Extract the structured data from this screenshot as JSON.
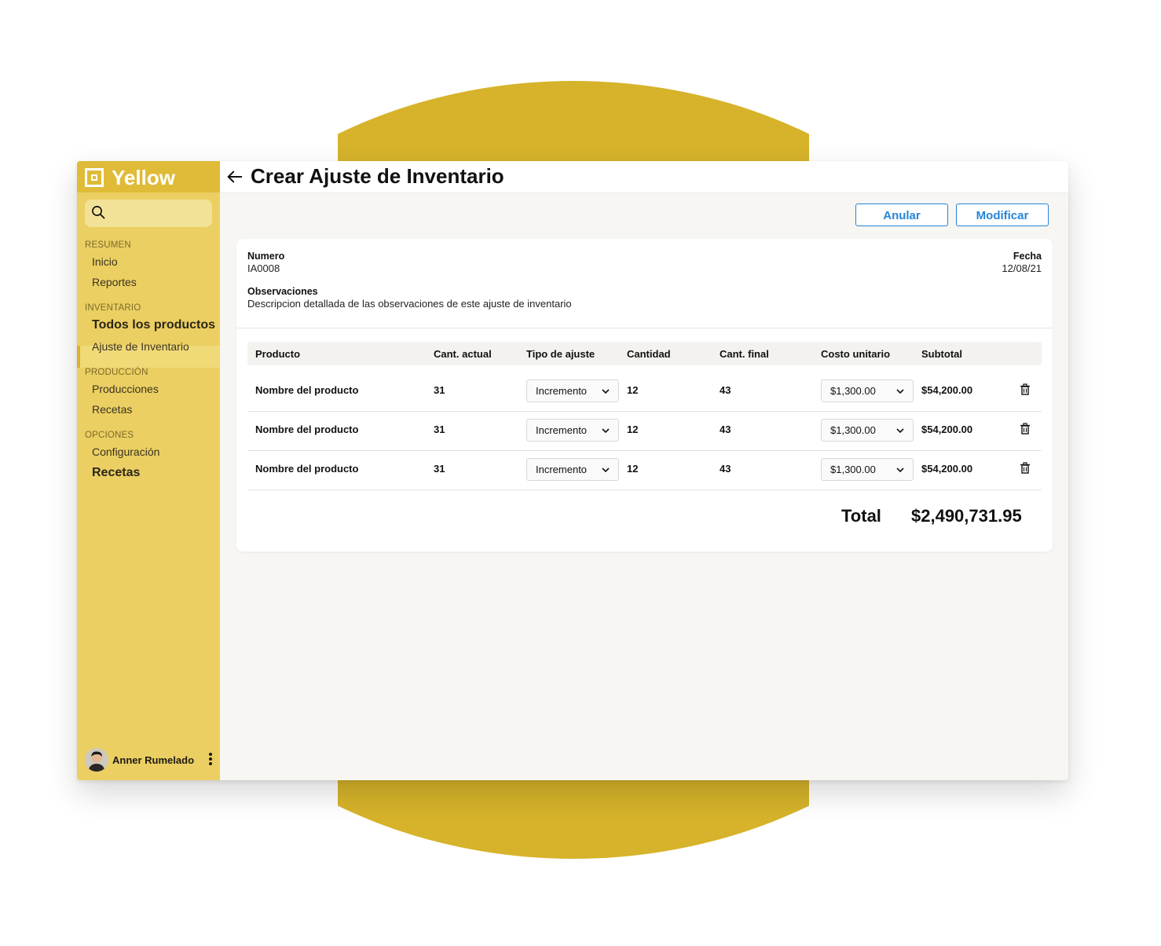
{
  "colors": {
    "accent_circle": "#d6b32a",
    "sidebar": "#ebcf62",
    "brand_bar": "#dfbb38",
    "primary_button": "#2684d8"
  },
  "brand": {
    "name": "Yellow"
  },
  "sidebar": {
    "sections": [
      {
        "title": "RESUMEN",
        "items": [
          "Inicio",
          "Reportes"
        ]
      },
      {
        "title": "INVENTARIO",
        "items": [
          "Todos los productos",
          "Ajuste de Inventario"
        ]
      },
      {
        "title": "PRODUCCIÓN",
        "items": [
          "Producciones",
          "Recetas"
        ]
      },
      {
        "title": "OPCIONES",
        "items": [
          "Configuración",
          "Recetas"
        ]
      }
    ],
    "user": {
      "name": "Anner Rumelado"
    }
  },
  "header": {
    "title": "Crear Ajuste de Inventario"
  },
  "actions": {
    "cancel_label": "Anular",
    "modify_label": "Modificar"
  },
  "details": {
    "numero_label": "Numero",
    "numero_value": "IA0008",
    "fecha_label": "Fecha",
    "fecha_value": "12/08/21",
    "observaciones_label": "Observaciones",
    "observaciones_value": "Descripcion detallada de las observaciones de este ajuste de inventario"
  },
  "table": {
    "columns": [
      "Producto",
      "Cant. actual",
      "Tipo de ajuste",
      "Cantidad",
      "Cant. final",
      "Costo unitario",
      "Subtotal"
    ],
    "rows": [
      {
        "producto": "Nombre del producto",
        "cant_actual": "31",
        "tipo": "Incremento",
        "cantidad": "12",
        "cant_final": "43",
        "costo": "$1,300.00",
        "subtotal": "$54,200.00"
      },
      {
        "producto": "Nombre del producto",
        "cant_actual": "31",
        "tipo": "Incremento",
        "cantidad": "12",
        "cant_final": "43",
        "costo": "$1,300.00",
        "subtotal": "$54,200.00"
      },
      {
        "producto": "Nombre del producto",
        "cant_actual": "31",
        "tipo": "Incremento",
        "cantidad": "12",
        "cant_final": "43",
        "costo": "$1,300.00",
        "subtotal": "$54,200.00"
      }
    ]
  },
  "totals": {
    "label": "Total",
    "value": "$2,490,731.95"
  }
}
